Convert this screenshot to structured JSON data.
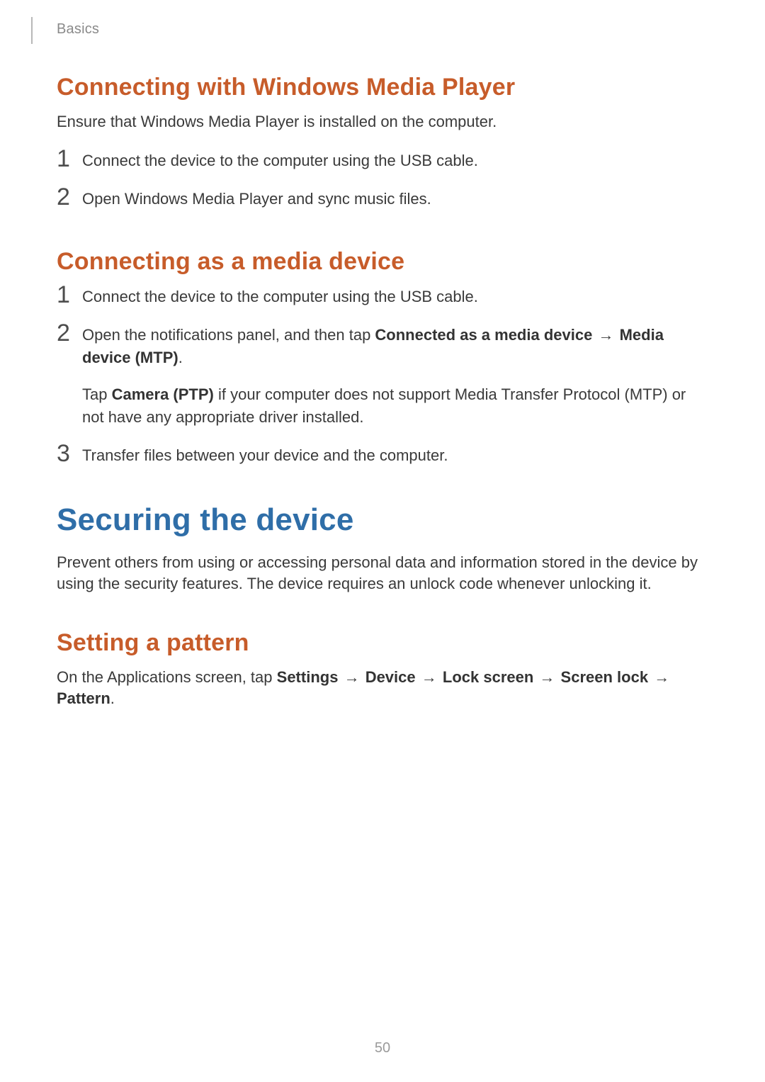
{
  "breadcrumb": "Basics",
  "page_number": "50",
  "arrow": "→",
  "s1": {
    "heading": "Connecting with Windows Media Player",
    "intro": "Ensure that Windows Media Player is installed on the computer.",
    "items": [
      {
        "num": "1",
        "text": "Connect the device to the computer using the USB cable."
      },
      {
        "num": "2",
        "text": "Open Windows Media Player and sync music files."
      }
    ]
  },
  "s2": {
    "heading": "Connecting as a media device",
    "items": {
      "i1": {
        "num": "1",
        "text": "Connect the device to the computer using the USB cable."
      },
      "i2": {
        "num": "2",
        "lead": "Open the notifications panel, and then tap ",
        "bold1": "Connected as a media device",
        "bold2": "Media device (MTP)",
        "period1": ".",
        "sub_lead": "Tap ",
        "sub_bold": "Camera (PTP)",
        "sub_tail": " if your computer does not support Media Transfer Protocol (MTP) or not have any appropriate driver installed."
      },
      "i3": {
        "num": "3",
        "text": "Transfer files between your device and the computer."
      }
    }
  },
  "s3": {
    "heading": "Securing the device",
    "intro": "Prevent others from using or accessing personal data and information stored in the device by using the security features. The device requires an unlock code whenever unlocking it."
  },
  "s4": {
    "heading": "Setting a pattern",
    "lead": "On the Applications screen, tap ",
    "path": [
      "Settings",
      "Device",
      "Lock screen",
      "Screen lock",
      "Pattern"
    ],
    "period": "."
  }
}
